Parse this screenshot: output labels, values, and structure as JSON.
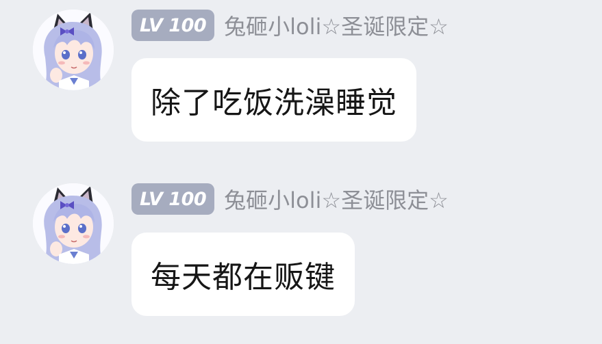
{
  "theme": {
    "background": "#eceef2",
    "badge_color": "#a6acbf",
    "name_color": "#8d8f96",
    "bubble_color": "#ffffff",
    "text_color": "#161616"
  },
  "messages": [
    {
      "sender": {
        "level_badge": "LV 100",
        "name": "兔砸小loli☆圣诞限定☆",
        "avatar_icon": "anime-girl-avatar-icon"
      },
      "text": "除了吃饭洗澡睡觉"
    },
    {
      "sender": {
        "level_badge": "LV 100",
        "name": "兔砸小loli☆圣诞限定☆",
        "avatar_icon": "anime-girl-avatar-icon"
      },
      "text": "每天都在贩键"
    }
  ]
}
